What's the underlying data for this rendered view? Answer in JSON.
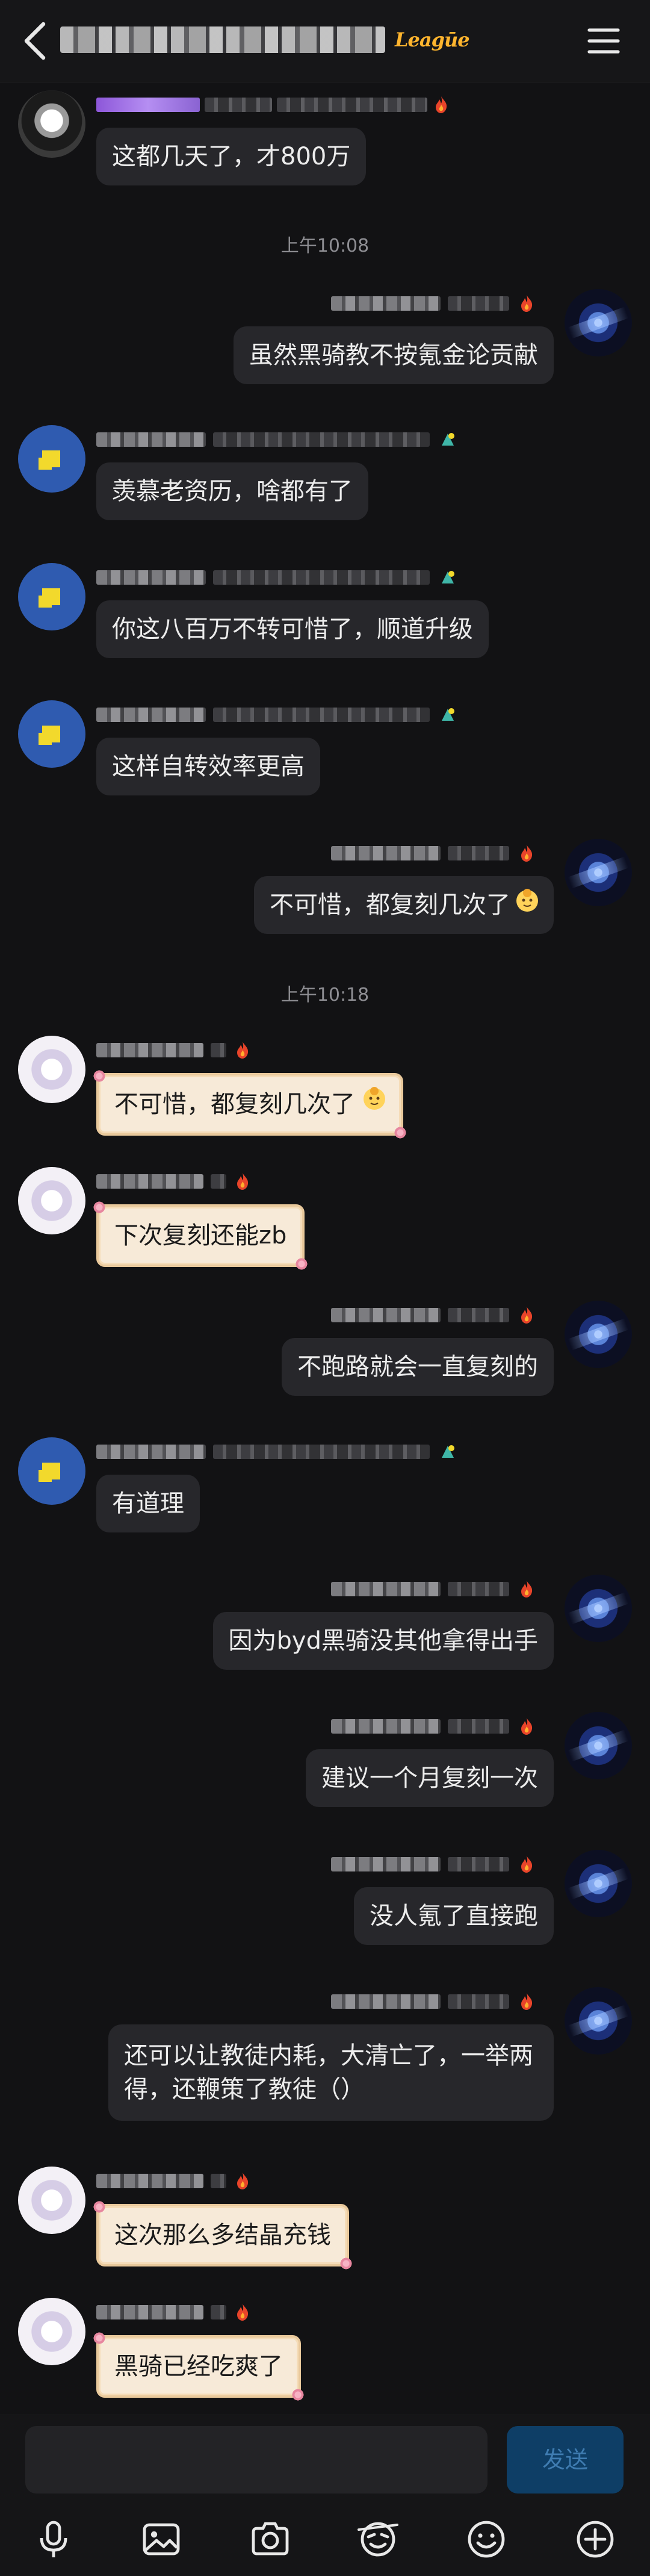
{
  "header": {
    "title_visible": "Leagūe"
  },
  "timestamps": [
    "上午10:08",
    "上午10:18"
  ],
  "messages": [
    {
      "side": "left",
      "text": "这都几天了，才800万"
    },
    {
      "side": "right",
      "text": "虽然黑骑教不按氪金论贡献"
    },
    {
      "side": "left",
      "text": "羡慕老资历，啥都有了"
    },
    {
      "side": "left",
      "text": "你这八百万不转可惜了，顺道升级"
    },
    {
      "side": "left",
      "text": "这样自转效率更高"
    },
    {
      "side": "right",
      "text": "不可惜，都复刻几次了"
    },
    {
      "side": "left",
      "text": "不可惜，都复刻几次了"
    },
    {
      "side": "left",
      "text": "下次复刻还能zb"
    },
    {
      "side": "right",
      "text": "不跑路就会一直复刻的"
    },
    {
      "side": "left",
      "text": "有道理"
    },
    {
      "side": "right",
      "text": "因为byd黑骑没其他拿得出手"
    },
    {
      "side": "right",
      "text": "建议一个月复刻一次"
    },
    {
      "side": "right",
      "text": "没人氪了直接跑"
    },
    {
      "side": "right",
      "text": "还可以让教徒内耗，大清亡了，一举两得，还鞭策了教徒（）"
    },
    {
      "side": "left",
      "text": "这次那么多结晶充钱"
    },
    {
      "side": "left",
      "text": "黑骑已经吃爽了"
    }
  ],
  "composer": {
    "send_label": "发送"
  },
  "icons": [
    "back-icon",
    "menu-icon",
    "fire-icon",
    "microphone-icon",
    "image-icon",
    "camera-icon",
    "sticker-icon",
    "emoji-icon",
    "plus-icon"
  ],
  "colors": {
    "bg": "#121214",
    "bubble": "#27272b",
    "framed_bubble": "#f7ead8",
    "send_button": "#0e3e66",
    "fire": "#e8442a"
  }
}
